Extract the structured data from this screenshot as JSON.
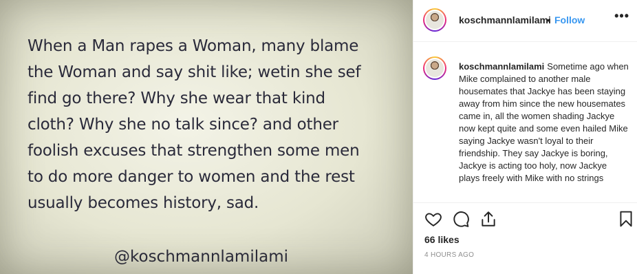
{
  "post_image": {
    "quote_lines": [
      "When a Man rapes a Woman, many blame",
      "the Woman and say shit like; wetin she sef",
      "find go there? Why she wear that kind",
      "cloth? Why she no talk since? and other",
      "foolish excuses that strengthen some men",
      "to do more danger to women and the rest",
      "usually becomes history, sad."
    ],
    "watermark": "@koschmannlamilami"
  },
  "header": {
    "username": "koschmannlamilami",
    "separator": "•",
    "follow_label": "Follow",
    "more_label": "•••"
  },
  "caption": {
    "username": "koschmannlamilami",
    "text": "Sometime ago when Mike complained to another male housemates that Jackye has been staying away from him since the new housemates came in, all the women shading Jackye now kept quite and some even hailed Mike saying Jackye wasn't loyal to their friendship. They say Jackye is boring, Jackye is acting too holy, now Jackye plays freely with Mike with no strings"
  },
  "actions": {
    "icons": [
      "heart-icon",
      "comment-icon",
      "share-icon",
      "bookmark-icon"
    ],
    "likes": "66 likes",
    "timestamp": "4 HOURS AGO"
  },
  "colors": {
    "link": "#3897f0",
    "text": "#262626",
    "muted": "#8e8e8e",
    "image_bg": "#e6e6d2"
  }
}
